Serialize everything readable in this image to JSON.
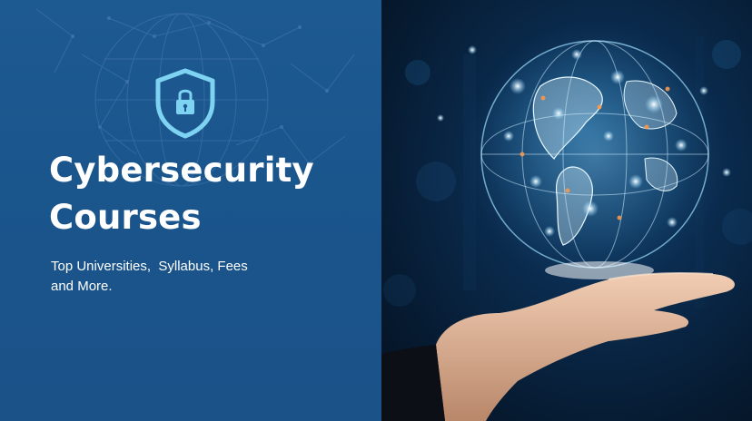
{
  "banner": {
    "title_line1": "Cybersecurity",
    "title_line2": "Courses",
    "subtitle": "Top Universities,  Syllabus, Fees\nand More."
  },
  "icons": {
    "shield": "shield-lock-icon",
    "globe": "digital-globe-icon",
    "hand": "open-hand"
  },
  "colors": {
    "left_panel": "#1c5690",
    "accent": "#7fd3f2",
    "text": "#ffffff",
    "right_bg": "#0a2a4c"
  }
}
